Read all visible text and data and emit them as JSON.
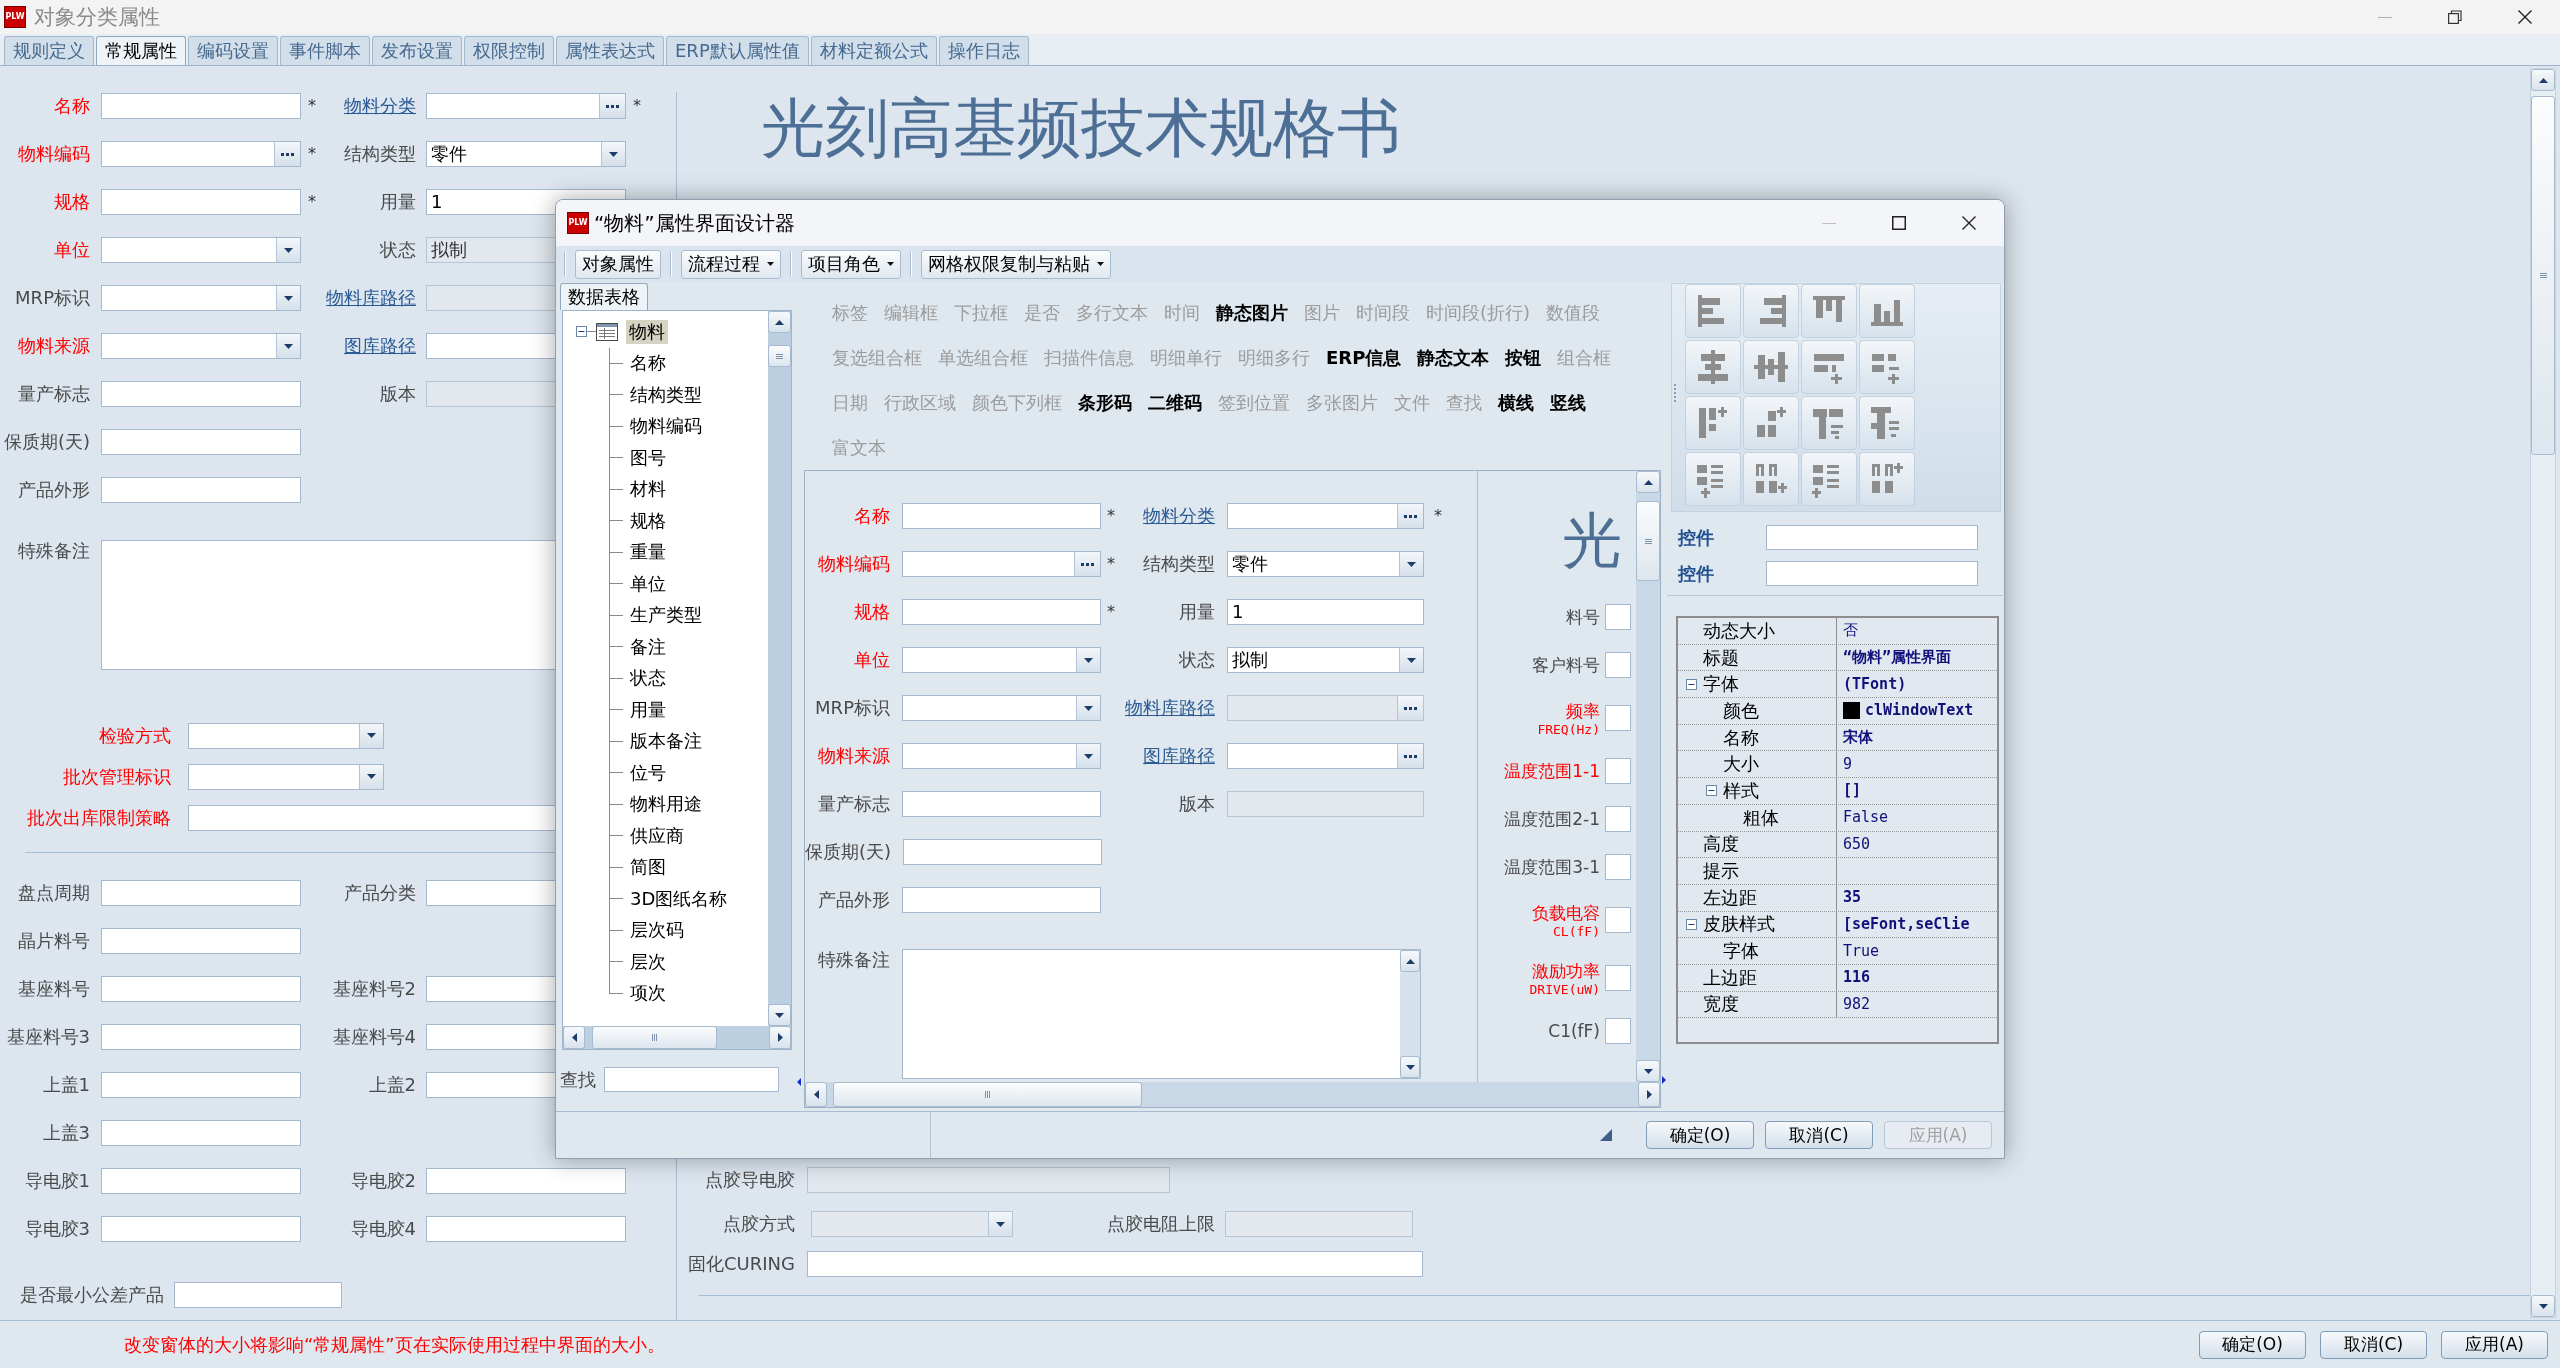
{
  "window": {
    "icon_text": "PLW",
    "title": "对象分类属性"
  },
  "tabs": [
    {
      "label": "规则定义",
      "selected": false
    },
    {
      "label": "常规属性",
      "selected": true
    },
    {
      "label": "编码设置",
      "selected": false
    },
    {
      "label": "事件脚本",
      "selected": false
    },
    {
      "label": "发布设置",
      "selected": false
    },
    {
      "label": "权限控制",
      "selected": false
    },
    {
      "label": "属性表达式",
      "selected": false
    },
    {
      "label": "ERP默认属性值",
      "selected": false
    },
    {
      "label": "材料定额公式",
      "selected": false
    },
    {
      "label": "操作日志",
      "selected": false
    }
  ],
  "form": {
    "top_rows": [
      [
        {
          "label": "名称",
          "required": true,
          "link": false,
          "kind": "text",
          "disabled": false,
          "mark": "*"
        },
        {
          "label": "物料分类",
          "required": false,
          "link": true,
          "kind": "browse",
          "disabled": false,
          "mark": "*"
        }
      ],
      [
        {
          "label": "物料编码",
          "required": true,
          "link": false,
          "kind": "browse",
          "disabled": false,
          "mark": "*"
        },
        {
          "label": "结构类型",
          "required": false,
          "link": false,
          "kind": "dropdown",
          "disabled": false,
          "value": "零件"
        }
      ],
      [
        {
          "label": "规格",
          "required": true,
          "link": false,
          "kind": "text",
          "disabled": false,
          "mark": "*"
        },
        {
          "label": "用量",
          "required": false,
          "link": false,
          "kind": "text",
          "disabled": false,
          "value": "1"
        }
      ],
      [
        {
          "label": "单位",
          "required": true,
          "link": false,
          "kind": "dropdown",
          "disabled": false
        },
        {
          "label": "状态",
          "required": false,
          "link": false,
          "kind": "dropdown",
          "disabled": true,
          "value": "拟制"
        }
      ],
      [
        {
          "label": "MRP标识",
          "required": false,
          "link": false,
          "kind": "dropdown",
          "disabled": false
        },
        {
          "label": "物料库路径",
          "required": false,
          "link": true,
          "kind": "browse",
          "disabled": true
        }
      ],
      [
        {
          "label": "物料来源",
          "required": true,
          "link": false,
          "kind": "dropdown",
          "disabled": false
        },
        {
          "label": "图库路径",
          "required": false,
          "link": true,
          "kind": "browse",
          "disabled": false
        }
      ],
      [
        {
          "label": "量产标志",
          "required": false,
          "link": false,
          "kind": "text",
          "disabled": false
        },
        {
          "label": "版本",
          "required": false,
          "link": false,
          "kind": "text",
          "disabled": true
        }
      ],
      [
        {
          "label": "保质期(天)",
          "required": false,
          "link": false,
          "kind": "text",
          "disabled": false
        }
      ],
      [
        {
          "label": "产品外形",
          "required": false,
          "link": false,
          "kind": "text",
          "disabled": false
        }
      ]
    ],
    "memo": {
      "label": "特殊备注",
      "required": false,
      "link": false,
      "kind": "memo",
      "disabled": false
    },
    "batch_rows": [
      {
        "label": "检验方式",
        "required": true,
        "link": false,
        "kind": "dropdown",
        "disabled": false
      },
      {
        "label": "批次管理标识",
        "required": true,
        "link": false,
        "kind": "dropdown",
        "disabled": false
      },
      {
        "label": "批次出库限制策略",
        "required": true,
        "link": false,
        "kind": "text",
        "disabled": false
      }
    ],
    "bottom_rows": [
      [
        {
          "label": "盘点周期",
          "required": false,
          "link": false,
          "kind": "text",
          "disabled": false
        },
        {
          "label": "产品分类",
          "required": false,
          "link": false,
          "kind": "text",
          "disabled": false
        }
      ],
      [
        {
          "label": "晶片料号",
          "required": false,
          "link": false,
          "kind": "text",
          "disabled": false
        }
      ],
      [
        {
          "label": "基座料号",
          "required": false,
          "link": false,
          "kind": "text",
          "disabled": false
        },
        {
          "label": "基座料号2",
          "required": false,
          "link": false,
          "kind": "text",
          "disabled": false
        }
      ],
      [
        {
          "label": "基座料号3",
          "required": false,
          "link": false,
          "kind": "text",
          "disabled": false
        },
        {
          "label": "基座料号4",
          "required": false,
          "link": false,
          "kind": "text",
          "disabled": false
        }
      ],
      [
        {
          "label": "上盖1",
          "required": false,
          "link": false,
          "kind": "text",
          "disabled": false
        },
        {
          "label": "上盖2",
          "required": false,
          "link": false,
          "kind": "text",
          "disabled": false
        }
      ],
      [
        {
          "label": "上盖3",
          "required": false,
          "link": false,
          "kind": "text",
          "disabled": false
        }
      ],
      [
        {
          "label": "导电胶1",
          "required": false,
          "link": false,
          "kind": "text",
          "disabled": false
        },
        {
          "label": "导电胶2",
          "required": false,
          "link": false,
          "kind": "text",
          "disabled": false
        }
      ],
      [
        {
          "label": "导电胶3",
          "required": false,
          "link": false,
          "kind": "text",
          "disabled": false
        },
        {
          "label": "导电胶4",
          "required": false,
          "link": false,
          "kind": "text",
          "disabled": false
        }
      ]
    ],
    "last_row": {
      "label": "是否最小公差产品",
      "required": false,
      "link": false,
      "kind": "text",
      "disabled": false
    }
  },
  "main": {
    "title": "光刻高基频技术规格书",
    "rows": [
      [
        {
          "label": "点胶导电胶",
          "required": false,
          "link": false,
          "kind": "text",
          "disabled": true
        }
      ],
      [
        {
          "label": "点胶方式",
          "required": false,
          "link": false,
          "kind": "dropdown",
          "disabled": true
        },
        {
          "label": "点胶电阻上限",
          "required": false,
          "link": false,
          "kind": "text",
          "disabled": true
        }
      ],
      [
        {
          "label": "固化CURING",
          "required": false,
          "link": false,
          "kind": "text",
          "disabled": false
        }
      ]
    ]
  },
  "status": {
    "message": "改变窗体的大小将影响“常规属性”页在实际使用过程中界面的大小。",
    "buttons": [
      {
        "label": "确定(O)",
        "disabled": false
      },
      {
        "label": "取消(C)",
        "disabled": false
      },
      {
        "label": "应用(A)",
        "disabled": false
      }
    ]
  },
  "designer": {
    "icon_text": "PLW",
    "title": "“物料”属性界面设计器",
    "toolbar": [
      {
        "label": "对象属性",
        "kind": "button"
      },
      {
        "label": "流程过程",
        "kind": "menu"
      },
      {
        "label": "项目角色",
        "kind": "menu"
      },
      {
        "label": "网格权限复制与粘贴",
        "kind": "menu"
      }
    ],
    "panel_tabs": [
      {
        "label": "数据表格",
        "selected": true
      }
    ],
    "tree": {
      "label": "物料",
      "selected": true,
      "expanded": true,
      "children": [
        {
          "label": "名称",
          "selected": false
        },
        {
          "label": "结构类型",
          "selected": false
        },
        {
          "label": "物料编码",
          "selected": false
        },
        {
          "label": "图号",
          "selected": false
        },
        {
          "label": "材料",
          "selected": false
        },
        {
          "label": "规格",
          "selected": false
        },
        {
          "label": "重量",
          "selected": false
        },
        {
          "label": "单位",
          "selected": false
        },
        {
          "label": "生产类型",
          "selected": false
        },
        {
          "label": "备注",
          "selected": false
        },
        {
          "label": "状态",
          "selected": false
        },
        {
          "label": "用量",
          "selected": false
        },
        {
          "label": "版本备注",
          "selected": false
        },
        {
          "label": "位号",
          "selected": false
        },
        {
          "label": "物料用途",
          "selected": false
        },
        {
          "label": "供应商",
          "selected": false
        },
        {
          "label": "简图",
          "selected": false
        },
        {
          "label": "3D图纸名称",
          "selected": false
        },
        {
          "label": "层次码",
          "selected": false
        },
        {
          "label": "层次",
          "selected": false
        },
        {
          "label": "项次",
          "selected": false
        }
      ]
    },
    "search": {
      "label": "查找"
    },
    "palette": [
      {
        "items": [
          {
            "label": "标签",
            "enabled": false
          },
          {
            "label": "编辑框",
            "enabled": false
          },
          {
            "label": "下拉框",
            "enabled": false
          },
          {
            "label": "是否",
            "enabled": false
          },
          {
            "label": "多行文本",
            "enabled": false
          },
          {
            "label": "时间",
            "enabled": false
          },
          {
            "label": "静态图片",
            "enabled": true
          },
          {
            "label": "图片",
            "enabled": false
          },
          {
            "label": "时间段",
            "enabled": false
          },
          {
            "label": "时间段(折行)",
            "enabled": false
          },
          {
            "label": "数值段",
            "enabled": false
          }
        ]
      },
      {
        "items": [
          {
            "label": "复选组合框",
            "enabled": false
          },
          {
            "label": "单选组合框",
            "enabled": false
          },
          {
            "label": "扫描件信息",
            "enabled": false
          },
          {
            "label": "明细单行",
            "enabled": false
          },
          {
            "label": "明细多行",
            "enabled": false
          },
          {
            "label": "ERP信息",
            "enabled": true
          },
          {
            "label": "静态文本",
            "enabled": true
          },
          {
            "label": "按钮",
            "enabled": true
          },
          {
            "label": "组合框",
            "enabled": false
          }
        ]
      },
      {
        "items": [
          {
            "label": "日期",
            "enabled": false
          },
          {
            "label": "行政区域",
            "enabled": false
          },
          {
            "label": "颜色下列框",
            "enabled": false
          },
          {
            "label": "条形码",
            "enabled": true
          },
          {
            "label": "二维码",
            "enabled": true
          },
          {
            "label": "签到位置",
            "enabled": false
          },
          {
            "label": "多张图片",
            "enabled": false
          },
          {
            "label": "文件",
            "enabled": false
          },
          {
            "label": "查找",
            "enabled": false
          },
          {
            "label": "横线",
            "enabled": true
          },
          {
            "label": "竖线",
            "enabled": true
          }
        ]
      },
      {
        "items": [
          {
            "label": "富文本",
            "enabled": false
          }
        ]
      }
    ],
    "canvas": {
      "rows": [
        [
          {
            "label": "名称",
            "required": true,
            "link": false,
            "kind": "text",
            "disabled": false,
            "mark": "*"
          },
          {
            "label": "物料分类",
            "required": false,
            "link": true,
            "kind": "browse",
            "disabled": false,
            "mark": "*"
          }
        ],
        [
          {
            "label": "物料编码",
            "required": true,
            "link": false,
            "kind": "browse",
            "disabled": false,
            "mark": "*"
          },
          {
            "label": "结构类型",
            "required": false,
            "link": false,
            "kind": "dropdown",
            "disabled": false,
            "value": "零件"
          }
        ],
        [
          {
            "label": "规格",
            "required": true,
            "link": false,
            "kind": "text",
            "disabled": false,
            "mark": "*"
          },
          {
            "label": "用量",
            "required": false,
            "link": false,
            "kind": "text",
            "disabled": false,
            "value": "1"
          }
        ],
        [
          {
            "label": "单位",
            "required": true,
            "link": false,
            "kind": "dropdown",
            "disabled": false
          },
          {
            "label": "状态",
            "required": false,
            "link": false,
            "kind": "dropdown",
            "disabled": false,
            "value": "拟制"
          }
        ],
        [
          {
            "label": "MRP标识",
            "required": false,
            "link": false,
            "kind": "dropdown",
            "disabled": false
          },
          {
            "label": "物料库路径",
            "required": false,
            "link": true,
            "kind": "browse",
            "disabled": true
          }
        ],
        [
          {
            "label": "物料来源",
            "required": true,
            "link": false,
            "kind": "dropdown",
            "disabled": false
          },
          {
            "label": "图库路径",
            "required": false,
            "link": true,
            "kind": "browse",
            "disabled": false
          }
        ],
        [
          {
            "label": "量产标志",
            "required": false,
            "link": false,
            "kind": "text",
            "disabled": false
          },
          {
            "label": "版本",
            "required": false,
            "link": false,
            "kind": "text",
            "disabled": true
          }
        ],
        [
          {
            "label": "保质期(天)",
            "required": false,
            "link": false,
            "kind": "text",
            "disabled": false
          }
        ],
        [
          {
            "label": "产品外形",
            "required": false,
            "link": false,
            "kind": "text",
            "disabled": false
          }
        ]
      ],
      "memo": {
        "label": "特殊备注",
        "required": false,
        "link": false,
        "kind": "memo",
        "disabled": false
      },
      "title": "光",
      "side_fields": [
        {
          "label": "料号",
          "required": false,
          "kind": "text"
        },
        {
          "label": "客户料号",
          "required": false,
          "kind": "text"
        },
        {
          "label": "频率",
          "sub": "FREQ(Hz)",
          "required": true,
          "kind": "text"
        },
        {
          "label": "温度范围1-1",
          "required": true,
          "kind": "text"
        },
        {
          "label": "温度范围2-1",
          "required": false,
          "kind": "text"
        },
        {
          "label": "温度范围3-1",
          "required": false,
          "kind": "text"
        },
        {
          "label": "负载电容",
          "sub": "CL(fF)",
          "required": true,
          "kind": "text"
        },
        {
          "label": "激励功率",
          "sub": "DRIVE(uW)",
          "required": true,
          "kind": "text"
        },
        {
          "label": "C1(fF)",
          "required": false,
          "kind": "text"
        }
      ]
    },
    "controls": [
      {
        "label": "控件"
      },
      {
        "label": "控件"
      }
    ],
    "properties": [
      {
        "name": "动态大小",
        "value": "否",
        "modified": false
      },
      {
        "name": "标题",
        "value": "“物料”属性界面",
        "modified": true
      },
      {
        "name": "字体",
        "value": "(TFont)",
        "modified": true,
        "expanded": true,
        "children": [
          {
            "name": "颜色",
            "value": "clWindowText",
            "modified": true,
            "color": "#000000"
          },
          {
            "name": "名称",
            "value": "宋体",
            "modified": true
          },
          {
            "name": "大小",
            "value": "9",
            "modified": false
          },
          {
            "name": "样式",
            "value": "[]",
            "modified": true,
            "expanded": true,
            "children": [
              {
                "name": "粗体",
                "value": "False",
                "modified": false
              }
            ]
          }
        ]
      },
      {
        "name": "高度",
        "value": "650",
        "modified": false
      },
      {
        "name": "提示"
      },
      {
        "name": "左边距",
        "value": "35",
        "modified": true
      },
      {
        "name": "皮肤样式",
        "value": "[seFont,seClie",
        "modified": true,
        "expanded": true,
        "children": [
          {
            "name": "字体",
            "value": "True",
            "modified": false
          }
        ]
      },
      {
        "name": "上边距",
        "value": "116",
        "modified": true
      },
      {
        "name": "宽度",
        "value": "982",
        "modified": false
      }
    ],
    "buttons": [
      {
        "label": "确定(O)",
        "disabled": false
      },
      {
        "label": "取消(C)",
        "disabled": false
      },
      {
        "label": "应用(A)",
        "disabled": true
      }
    ]
  }
}
